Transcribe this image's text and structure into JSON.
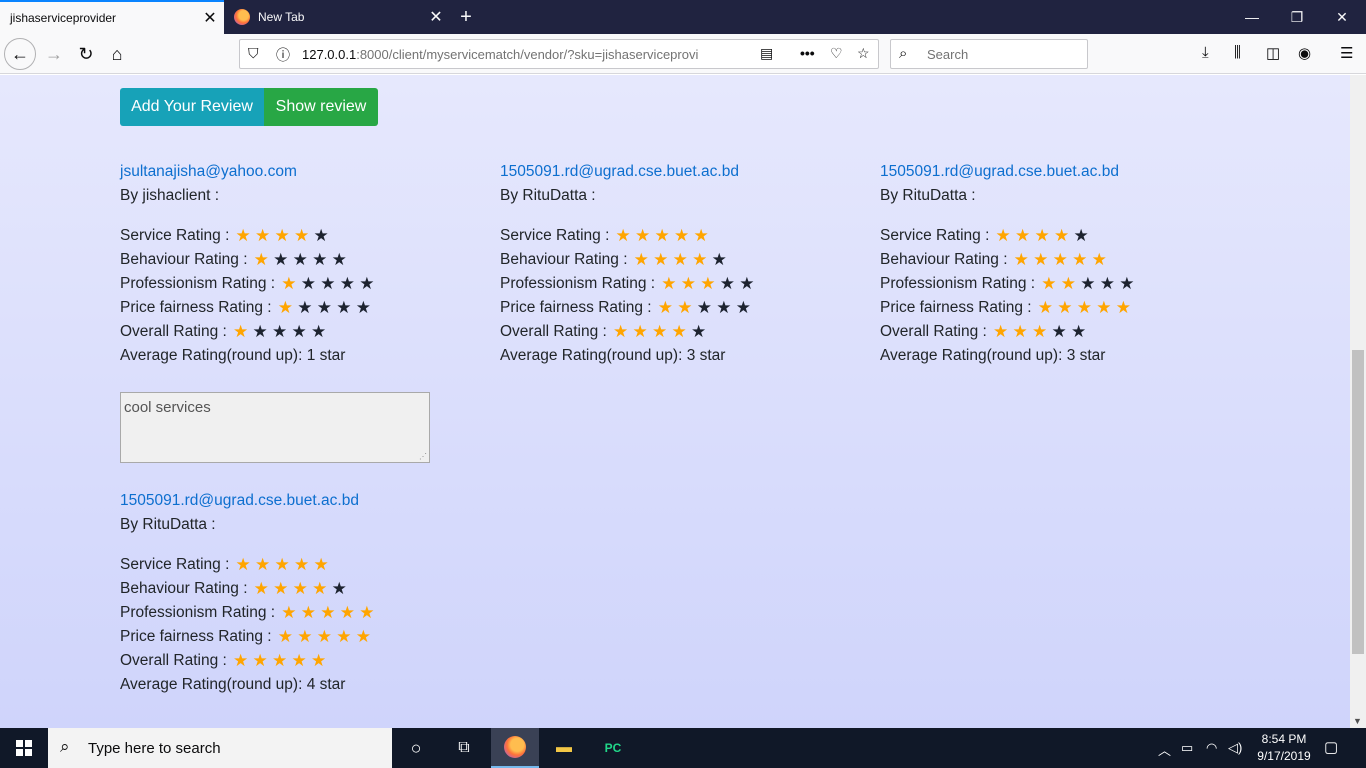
{
  "browser": {
    "active_tab_title": "jishaserviceprovider",
    "inactive_tab_title": "New Tab",
    "url_host": "127.0.0.1",
    "url_rest": ":8000/client/myservicematch/vendor/?sku=jishaserviceprovi",
    "search_placeholder": "Search"
  },
  "page": {
    "add_review_label": "Add Your Review",
    "show_review_label": "Show review",
    "colors": {
      "star_on": "#ffa500",
      "star_off": "#1d2330",
      "add_btn": "#17a2b8",
      "show_btn": "#28a745"
    },
    "reviews": [
      {
        "email": "jsultanajisha@yahoo.com",
        "by": "By jishaclient :",
        "service_label": "Service Rating :",
        "service_stars": 4,
        "behaviour_label": "Behaviour Rating :",
        "behaviour_stars": 1,
        "professionism_label": "Professionism Rating :",
        "professionism_stars": 1,
        "price_label": "Price fairness Rating :",
        "price_stars": 1,
        "overall_label": "Overall Rating :",
        "overall_stars": 1,
        "average": "Average Rating(round up): 1 star",
        "comment": "cool services"
      },
      {
        "email": "1505091.rd@ugrad.cse.buet.ac.bd",
        "by": "By RituDatta :",
        "service_label": "Service Rating :",
        "service_stars": 5,
        "behaviour_label": "Behaviour Rating :",
        "behaviour_stars": 4,
        "professionism_label": "Professionism Rating :",
        "professionism_stars": 3,
        "price_label": "Price fairness Rating :",
        "price_stars": 2,
        "overall_label": "Overall Rating :",
        "overall_stars": 4,
        "average": "Average Rating(round up): 3 star"
      },
      {
        "email": "1505091.rd@ugrad.cse.buet.ac.bd",
        "by": "By RituDatta :",
        "service_label": "Service Rating :",
        "service_stars": 4,
        "behaviour_label": "Behaviour Rating :",
        "behaviour_stars": 5,
        "professionism_label": "Professionism Rating :",
        "professionism_stars": 2,
        "price_label": "Price fairness Rating :",
        "price_stars": 5,
        "overall_label": "Overall Rating :",
        "overall_stars": 3,
        "average": "Average Rating(round up): 3 star"
      },
      {
        "email": "1505091.rd@ugrad.cse.buet.ac.bd",
        "by": "By RituDatta :",
        "service_label": "Service Rating :",
        "service_stars": 5,
        "behaviour_label": "Behaviour Rating :",
        "behaviour_stars": 4,
        "professionism_label": "Professionism Rating :",
        "professionism_stars": 5,
        "price_label": "Price fairness Rating :",
        "price_stars": 5,
        "overall_label": "Overall Rating :",
        "overall_stars": 5,
        "average": "Average Rating(round up): 4 star"
      }
    ]
  },
  "taskbar": {
    "search_placeholder": "Type here to search",
    "time": "8:54 PM",
    "date": "9/17/2019"
  }
}
